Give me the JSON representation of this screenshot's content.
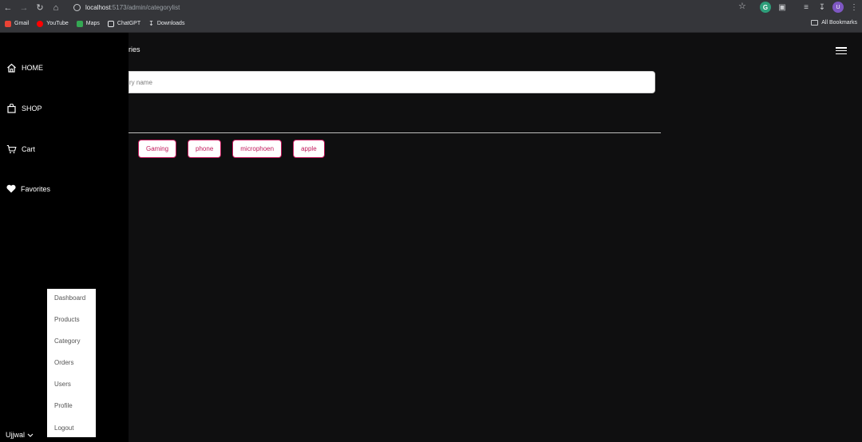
{
  "browser": {
    "url_host": "localhost",
    "url_path": ":5173/admin/categorylist",
    "bookmarks": [
      "Gmail",
      "YouTube",
      "Maps",
      "ChatGPT",
      "Downloads"
    ],
    "all_bookmarks": "All Bookmarks",
    "profile_initial": "U",
    "ext_initial": "G"
  },
  "sidebar": {
    "items": [
      {
        "label": "HOME",
        "icon": "home-icon"
      },
      {
        "label": "SHOP",
        "icon": "shopping-bag-icon"
      },
      {
        "label": "Cart",
        "icon": "cart-icon"
      },
      {
        "label": "Favorites",
        "icon": "heart-icon"
      }
    ],
    "user_name": "Ujjwal"
  },
  "main": {
    "title": "ries",
    "input_placeholder": "ry name",
    "categories": [
      "Gaming",
      "phone",
      "microphoen",
      "apple"
    ]
  },
  "dropdown": {
    "items": [
      "Dashboard",
      "Products",
      "Category",
      "Orders",
      "Users",
      "Profile",
      "Logout"
    ]
  },
  "colors": {
    "accent": "#c2185b",
    "sidebar_bg": "#000000",
    "page_bg": "#0f0f10"
  }
}
